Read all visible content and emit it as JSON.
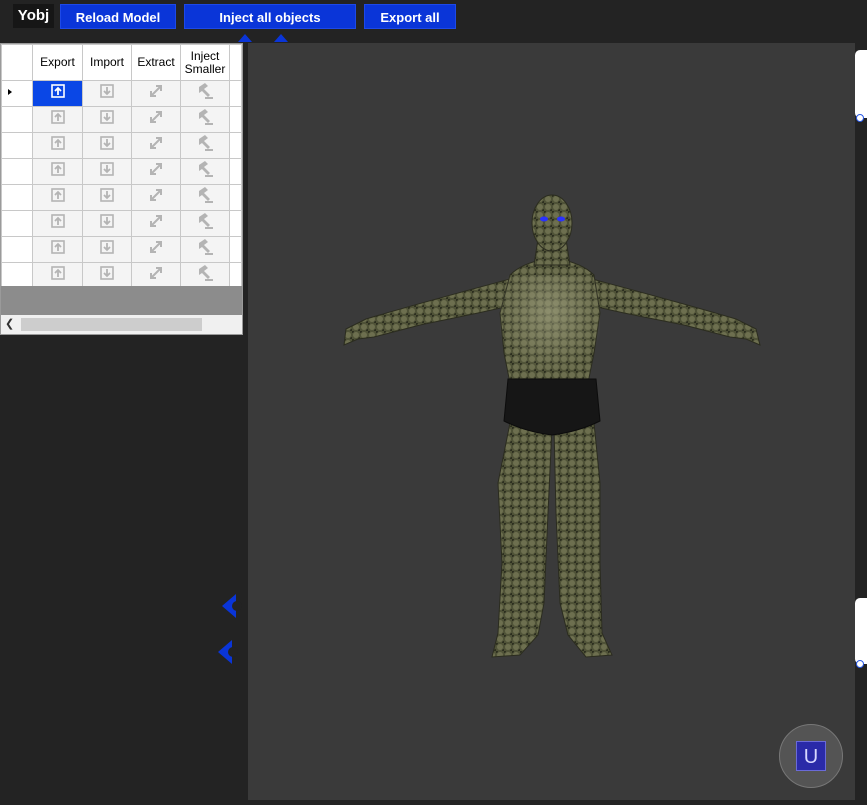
{
  "app": {
    "title": "Yobj"
  },
  "toolbar": {
    "reload_label": "Reload Model",
    "inject_all_label": "Inject all objects",
    "export_all_label": "Export all"
  },
  "grid": {
    "columns": [
      "Export",
      "Import",
      "Extract",
      "Inject Smaller"
    ],
    "row_count": 9,
    "selected_row": 0,
    "icons": {
      "export": "export-icon",
      "import": "import-icon",
      "extract": "extract-icon",
      "inject": "hammer-icon"
    }
  },
  "viewport": {
    "content": "3d-character-model",
    "u_button_label": "U"
  },
  "colors": {
    "accent": "#0a35d8",
    "background": "#232323",
    "viewport": "#3a3a3a",
    "selected": "#0a47e6"
  }
}
